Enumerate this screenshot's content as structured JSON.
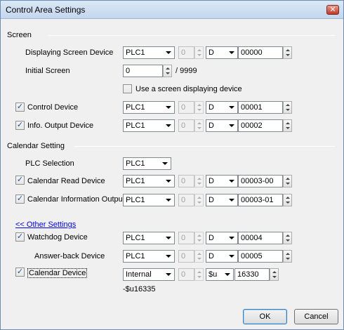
{
  "window": {
    "title": "Control Area Settings",
    "close_glyph": "✕"
  },
  "sections": {
    "screen": "Screen",
    "calendar": "Calendar Setting"
  },
  "rows": {
    "display_device": {
      "label": "Displaying Screen Device",
      "plc": "PLC1",
      "station": "0",
      "device": "D",
      "address": "00000"
    },
    "initial_screen": {
      "label": "Initial Screen",
      "value": "0",
      "max": "/ 9999"
    },
    "use_screen_device": {
      "label": "Use a screen displaying device",
      "checked": false
    },
    "control_device": {
      "label": "Control Device",
      "checked": true,
      "plc": "PLC1",
      "station": "0",
      "device": "D",
      "address": "00001"
    },
    "info_output": {
      "label": "Info. Output Device",
      "checked": true,
      "plc": "PLC1",
      "station": "0",
      "device": "D",
      "address": "00002"
    },
    "plc_selection": {
      "label": "PLC Selection",
      "plc": "PLC1"
    },
    "calendar_read": {
      "label": "Calendar Read Device",
      "checked": true,
      "plc": "PLC1",
      "station": "0",
      "device": "D",
      "address": "00003-00"
    },
    "calendar_info": {
      "label": "Calendar Information Output",
      "checked": true,
      "plc": "PLC1",
      "station": "0",
      "device": "D",
      "address": "00003-01"
    },
    "other_settings": {
      "label": "<< Other Settings"
    },
    "watchdog": {
      "label": "Watchdog Device",
      "checked": true,
      "plc": "PLC1",
      "station": "0",
      "device": "D",
      "address": "00004"
    },
    "answer_back": {
      "label": "Answer-back Device",
      "plc": "PLC1",
      "station": "0",
      "device": "D",
      "address": "00005"
    },
    "calendar_device": {
      "label": "Calendar Device",
      "checked": true,
      "plc": "Internal",
      "station": "0",
      "device": "$u",
      "address": "16330",
      "range_text": "-$u16335"
    }
  },
  "buttons": {
    "ok": "OK",
    "cancel": "Cancel"
  },
  "check_glyph": "✓"
}
